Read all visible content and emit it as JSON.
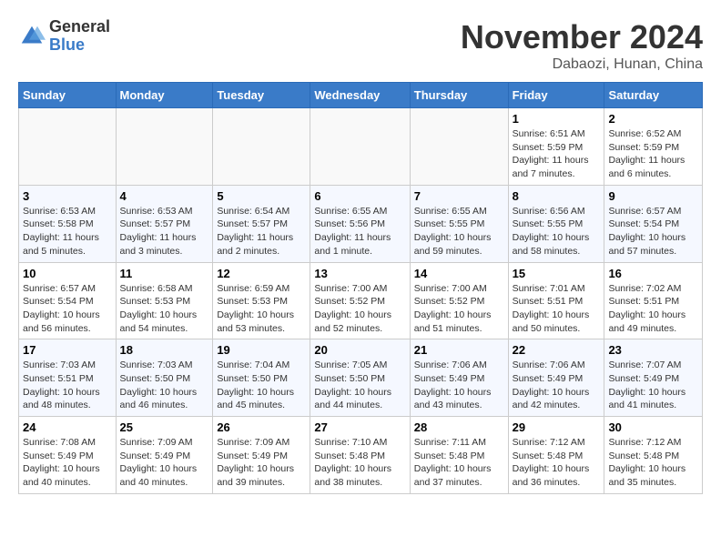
{
  "header": {
    "logo_general": "General",
    "logo_blue": "Blue",
    "month": "November 2024",
    "location": "Dabaozi, Hunan, China"
  },
  "calendar": {
    "days_of_week": [
      "Sunday",
      "Monday",
      "Tuesday",
      "Wednesday",
      "Thursday",
      "Friday",
      "Saturday"
    ],
    "weeks": [
      [
        {
          "day": "",
          "info": ""
        },
        {
          "day": "",
          "info": ""
        },
        {
          "day": "",
          "info": ""
        },
        {
          "day": "",
          "info": ""
        },
        {
          "day": "",
          "info": ""
        },
        {
          "day": "1",
          "info": "Sunrise: 6:51 AM\nSunset: 5:59 PM\nDaylight: 11 hours and 7 minutes."
        },
        {
          "day": "2",
          "info": "Sunrise: 6:52 AM\nSunset: 5:59 PM\nDaylight: 11 hours and 6 minutes."
        }
      ],
      [
        {
          "day": "3",
          "info": "Sunrise: 6:53 AM\nSunset: 5:58 PM\nDaylight: 11 hours and 5 minutes."
        },
        {
          "day": "4",
          "info": "Sunrise: 6:53 AM\nSunset: 5:57 PM\nDaylight: 11 hours and 3 minutes."
        },
        {
          "day": "5",
          "info": "Sunrise: 6:54 AM\nSunset: 5:57 PM\nDaylight: 11 hours and 2 minutes."
        },
        {
          "day": "6",
          "info": "Sunrise: 6:55 AM\nSunset: 5:56 PM\nDaylight: 11 hours and 1 minute."
        },
        {
          "day": "7",
          "info": "Sunrise: 6:55 AM\nSunset: 5:55 PM\nDaylight: 10 hours and 59 minutes."
        },
        {
          "day": "8",
          "info": "Sunrise: 6:56 AM\nSunset: 5:55 PM\nDaylight: 10 hours and 58 minutes."
        },
        {
          "day": "9",
          "info": "Sunrise: 6:57 AM\nSunset: 5:54 PM\nDaylight: 10 hours and 57 minutes."
        }
      ],
      [
        {
          "day": "10",
          "info": "Sunrise: 6:57 AM\nSunset: 5:54 PM\nDaylight: 10 hours and 56 minutes."
        },
        {
          "day": "11",
          "info": "Sunrise: 6:58 AM\nSunset: 5:53 PM\nDaylight: 10 hours and 54 minutes."
        },
        {
          "day": "12",
          "info": "Sunrise: 6:59 AM\nSunset: 5:53 PM\nDaylight: 10 hours and 53 minutes."
        },
        {
          "day": "13",
          "info": "Sunrise: 7:00 AM\nSunset: 5:52 PM\nDaylight: 10 hours and 52 minutes."
        },
        {
          "day": "14",
          "info": "Sunrise: 7:00 AM\nSunset: 5:52 PM\nDaylight: 10 hours and 51 minutes."
        },
        {
          "day": "15",
          "info": "Sunrise: 7:01 AM\nSunset: 5:51 PM\nDaylight: 10 hours and 50 minutes."
        },
        {
          "day": "16",
          "info": "Sunrise: 7:02 AM\nSunset: 5:51 PM\nDaylight: 10 hours and 49 minutes."
        }
      ],
      [
        {
          "day": "17",
          "info": "Sunrise: 7:03 AM\nSunset: 5:51 PM\nDaylight: 10 hours and 48 minutes."
        },
        {
          "day": "18",
          "info": "Sunrise: 7:03 AM\nSunset: 5:50 PM\nDaylight: 10 hours and 46 minutes."
        },
        {
          "day": "19",
          "info": "Sunrise: 7:04 AM\nSunset: 5:50 PM\nDaylight: 10 hours and 45 minutes."
        },
        {
          "day": "20",
          "info": "Sunrise: 7:05 AM\nSunset: 5:50 PM\nDaylight: 10 hours and 44 minutes."
        },
        {
          "day": "21",
          "info": "Sunrise: 7:06 AM\nSunset: 5:49 PM\nDaylight: 10 hours and 43 minutes."
        },
        {
          "day": "22",
          "info": "Sunrise: 7:06 AM\nSunset: 5:49 PM\nDaylight: 10 hours and 42 minutes."
        },
        {
          "day": "23",
          "info": "Sunrise: 7:07 AM\nSunset: 5:49 PM\nDaylight: 10 hours and 41 minutes."
        }
      ],
      [
        {
          "day": "24",
          "info": "Sunrise: 7:08 AM\nSunset: 5:49 PM\nDaylight: 10 hours and 40 minutes."
        },
        {
          "day": "25",
          "info": "Sunrise: 7:09 AM\nSunset: 5:49 PM\nDaylight: 10 hours and 40 minutes."
        },
        {
          "day": "26",
          "info": "Sunrise: 7:09 AM\nSunset: 5:49 PM\nDaylight: 10 hours and 39 minutes."
        },
        {
          "day": "27",
          "info": "Sunrise: 7:10 AM\nSunset: 5:48 PM\nDaylight: 10 hours and 38 minutes."
        },
        {
          "day": "28",
          "info": "Sunrise: 7:11 AM\nSunset: 5:48 PM\nDaylight: 10 hours and 37 minutes."
        },
        {
          "day": "29",
          "info": "Sunrise: 7:12 AM\nSunset: 5:48 PM\nDaylight: 10 hours and 36 minutes."
        },
        {
          "day": "30",
          "info": "Sunrise: 7:12 AM\nSunset: 5:48 PM\nDaylight: 10 hours and 35 minutes."
        }
      ]
    ]
  }
}
